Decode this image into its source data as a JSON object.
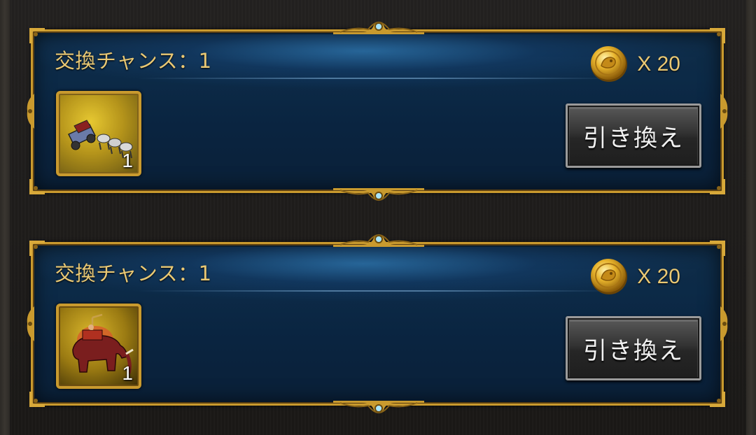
{
  "offers": [
    {
      "chance_text": "交換チャンス：1",
      "cost_icon": "gold-coin-icon",
      "cost_qty": "X 20",
      "item_icon": "carriage-unit-icon",
      "item_count": "1",
      "button_label": "引き換え"
    },
    {
      "chance_text": "交換チャンス：1",
      "cost_icon": "gold-coin-icon",
      "cost_qty": "X 20",
      "item_icon": "war-elephant-unit-icon",
      "item_count": "1",
      "button_label": "引き換え"
    }
  ],
  "colors": {
    "gold_text": "#e9c874",
    "frame_gold": "#c99a2e",
    "panel_blue": "#0c2a47"
  }
}
